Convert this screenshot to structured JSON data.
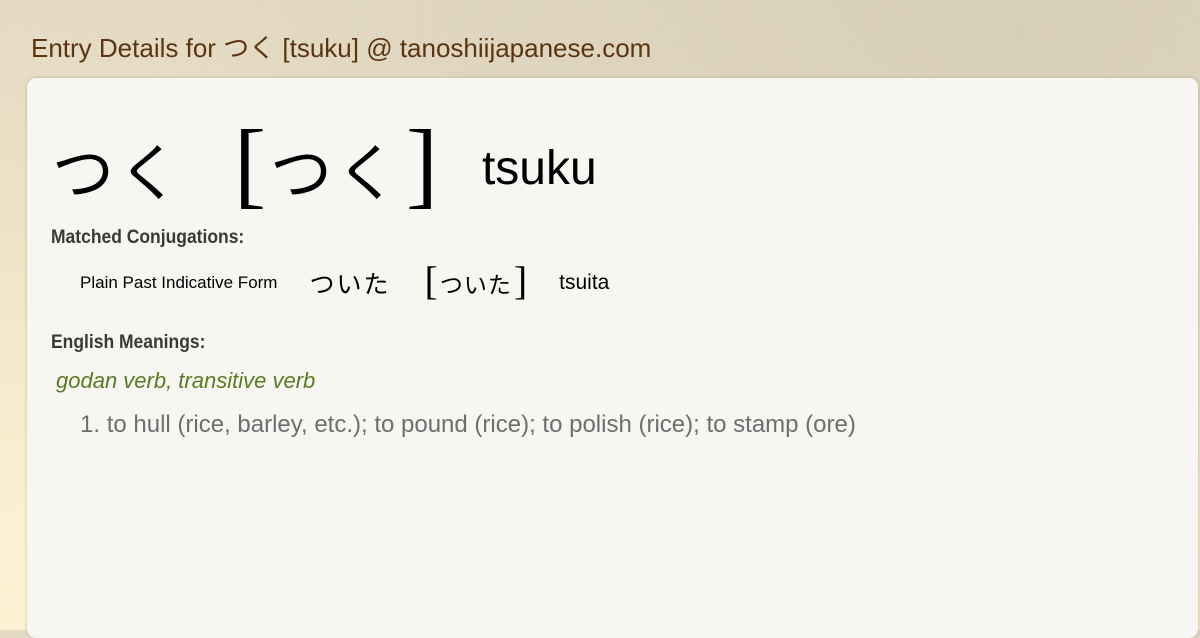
{
  "page": {
    "title": "Entry Details for つく [tsuku] @ tanoshiijapanese.com"
  },
  "entry": {
    "word": "つく",
    "reading_open_bracket": "[",
    "reading": "つく",
    "reading_close_bracket": "]",
    "romaji": "tsuku"
  },
  "conjugations": {
    "label": "Matched Conjugations:",
    "items": [
      {
        "form": "Plain Past Indicative Form",
        "word": "ついた",
        "reading_open_bracket": "[",
        "reading": "ついた",
        "reading_close_bracket": "]",
        "romaji": "tsuita"
      }
    ]
  },
  "meanings": {
    "label": "English Meanings:",
    "part_of_speech": "godan verb, transitive verb",
    "items": [
      {
        "number": "1.",
        "text": "to hull (rice, barley, etc.); to pound (rice); to polish (rice); to stamp (ore)"
      }
    ]
  },
  "colors": {
    "title": "#5b3511",
    "part_of_speech": "#5a7a23",
    "meaning_text": "#6e6e6e",
    "card_background": "#f7f6f2"
  }
}
